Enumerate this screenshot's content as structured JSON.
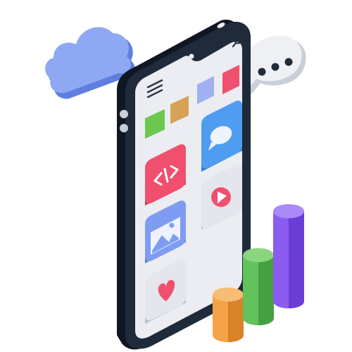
{
  "colors": {
    "background": "#ffffff",
    "phone_frame": "#1f2a3a",
    "phone_frame_side": "#0f1724",
    "screen": "#ecedf2",
    "cloud": "#8ea8f3",
    "cloud_shadow": "#5f7fe0",
    "bubble": "#eef0f4",
    "bubble_shadow": "#c9ced8",
    "bubble_dots": "#1f2a3a",
    "code_app": "#f0506e",
    "message_app": "#4f9df0",
    "video_app_bg": "#e4e6ec",
    "video_play": "#f0506e",
    "gallery_app": "#7e9cf2",
    "heart_app_bg": "#e4e6ec",
    "heart": "#f0506e",
    "chip_green": "#6cc74f",
    "chip_tan": "#d6a255",
    "chip_periwinkle": "#9fb0f3",
    "chip_red": "#f0506e",
    "bar_orange": "#f5a248",
    "bar_green": "#62c25b",
    "bar_purple": "#8a5cf0"
  },
  "icons": {
    "cloud": "cloud-icon",
    "chat_bubble": "speech-bubble-icon",
    "search": "search-icon",
    "menu": "hamburger-menu-icon",
    "code": "code-brackets-icon",
    "message": "message-bubble-icon",
    "video": "play-icon",
    "gallery": "image-mountains-icon",
    "heart": "heart-icon"
  },
  "chart_bars": [
    {
      "name": "orange",
      "level": 0.45
    },
    {
      "name": "green",
      "level": 0.7
    },
    {
      "name": "purple",
      "level": 1.0
    }
  ]
}
